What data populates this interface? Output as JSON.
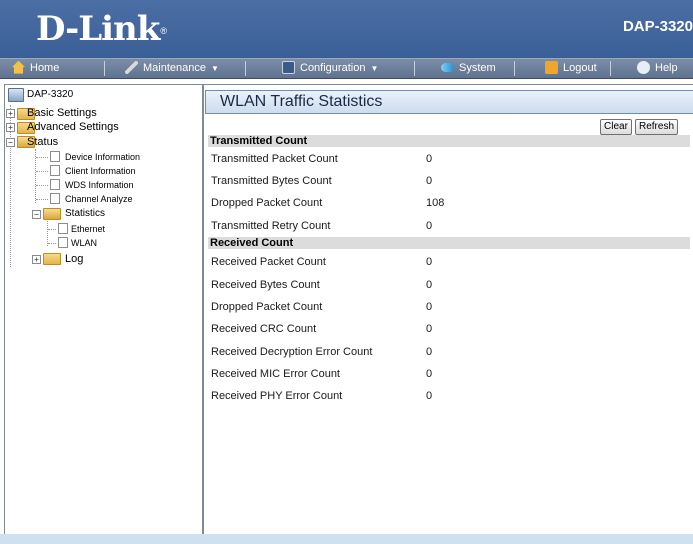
{
  "header": {
    "logo": "D-Link",
    "logo_mark": "®",
    "model": "DAP-3320"
  },
  "nav": {
    "home": "Home",
    "maintenance": "Maintenance",
    "configuration": "Configuration",
    "system": "System",
    "logout": "Logout",
    "help": "Help",
    "caret": "▼"
  },
  "tree": {
    "root": "DAP-3320",
    "basic_settings": "Basic Settings",
    "advanced_settings": "Advanced Settings",
    "status": "Status",
    "device_information": "Device Information",
    "client_information": "Client Information",
    "wds_information": "WDS Information",
    "channel_analyze": "Channel Analyze",
    "statistics": "Statistics",
    "ethernet": "Ethernet",
    "wlan": "WLAN",
    "log": "Log",
    "expand": "+",
    "collapse": "−"
  },
  "page": {
    "title": "WLAN Traffic Statistics",
    "clear_button": "Clear",
    "refresh_button": "Refresh"
  },
  "transmitted": {
    "heading": "Transmitted Count",
    "rows": [
      {
        "label": "Transmitted Packet Count",
        "value": "0"
      },
      {
        "label": "Transmitted Bytes Count",
        "value": "0"
      },
      {
        "label": "Dropped Packet Count",
        "value": "108"
      },
      {
        "label": "Transmitted Retry Count",
        "value": "0"
      }
    ]
  },
  "received": {
    "heading": "Received Count",
    "rows": [
      {
        "label": "Received Packet Count",
        "value": "0"
      },
      {
        "label": "Received Bytes Count",
        "value": "0"
      },
      {
        "label": "Dropped Packet Count",
        "value": "0"
      },
      {
        "label": "Received CRC Count",
        "value": "0"
      },
      {
        "label": "Received Decryption Error Count",
        "value": "0"
      },
      {
        "label": "Received MIC Error Count",
        "value": "0"
      },
      {
        "label": "Received PHY Error Count",
        "value": "0"
      }
    ]
  },
  "icons": {
    "home": "house-icon",
    "maintenance": "wrench-icon",
    "configuration": "floppy-icon",
    "system": "arrows-icon",
    "logout": "logout-icon",
    "help": "help-icon"
  },
  "colors": {
    "header": "#3a5e96",
    "navbar": "#6a7c98",
    "section": "#dcdcdc",
    "title_bar": "#cddcee"
  }
}
